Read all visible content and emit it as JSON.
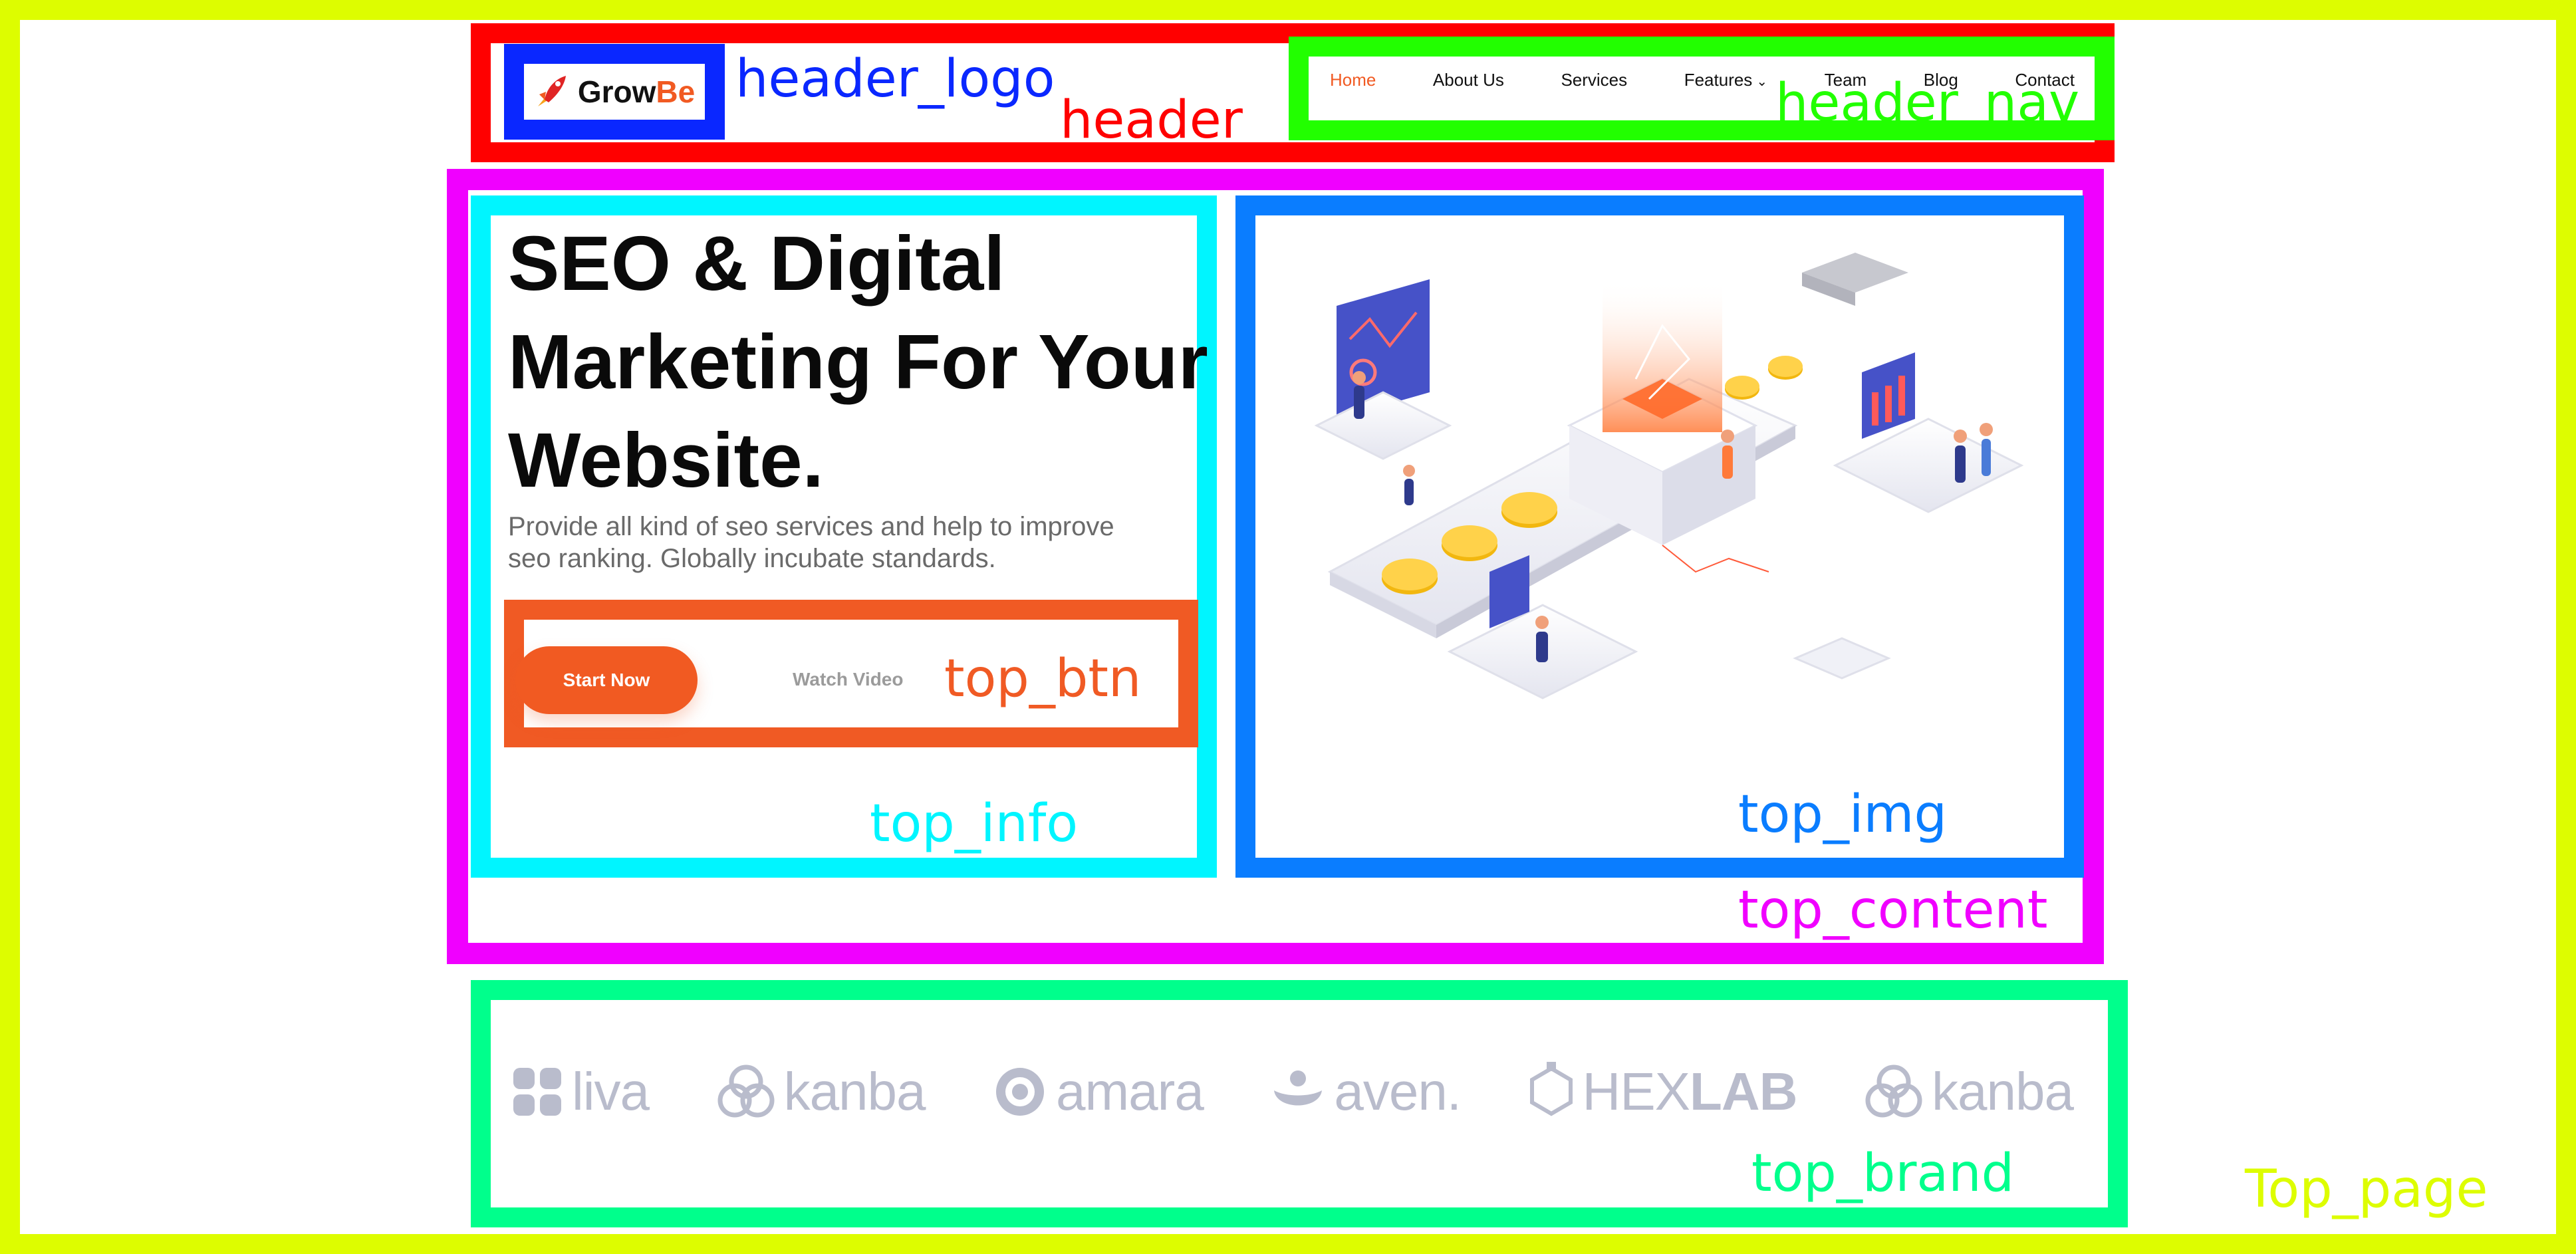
{
  "header": {
    "logo": {
      "text_main": "Grow",
      "text_accent": "Be"
    },
    "nav": [
      {
        "label": "Home",
        "active": true
      },
      {
        "label": "About Us"
      },
      {
        "label": "Services"
      },
      {
        "label": "Features",
        "has_dropdown": true
      },
      {
        "label": "Team"
      },
      {
        "label": "Blog"
      },
      {
        "label": "Contact"
      }
    ]
  },
  "hero": {
    "title_lines": [
      "SEO & Digital",
      "Marketing For Your",
      "Website."
    ],
    "subtitle_lines": [
      "Provide all kind of seo services and help to improve",
      "seo ranking. Globally incubate standards."
    ],
    "start_button": "Start Now",
    "watch_button": "Watch Video"
  },
  "brands": [
    {
      "name": "liva",
      "icon": "liva-icon"
    },
    {
      "name": "kanba",
      "icon": "kanba-icon"
    },
    {
      "name": "amara",
      "icon": "amara-icon"
    },
    {
      "name": "aven.",
      "icon": "aven-icon"
    },
    {
      "name_light": "HEX",
      "name_bold": "LAB",
      "icon": "hexlab-icon"
    },
    {
      "name": "kanba",
      "icon": "kanba-icon"
    }
  ],
  "annotations": {
    "header": "header",
    "header_logo": "header_logo",
    "header_nav": "header_nav",
    "top_content": "top_content",
    "top_info": "top_info",
    "top_img": "top_img",
    "top_btn": "top_btn",
    "top_brand": "top_brand",
    "top_page": "Top_page"
  },
  "colors": {
    "accent": "#f15a22",
    "outline_page": "#ddfd00",
    "outline_header": "#ff0000",
    "outline_logo": "#0a27ff",
    "outline_nav": "#22ff00",
    "outline_content": "#f000ff",
    "outline_info": "#00f5ff",
    "outline_img": "#0a7dff",
    "outline_btn": "#f05a24",
    "outline_brand": "#00ff8c"
  }
}
